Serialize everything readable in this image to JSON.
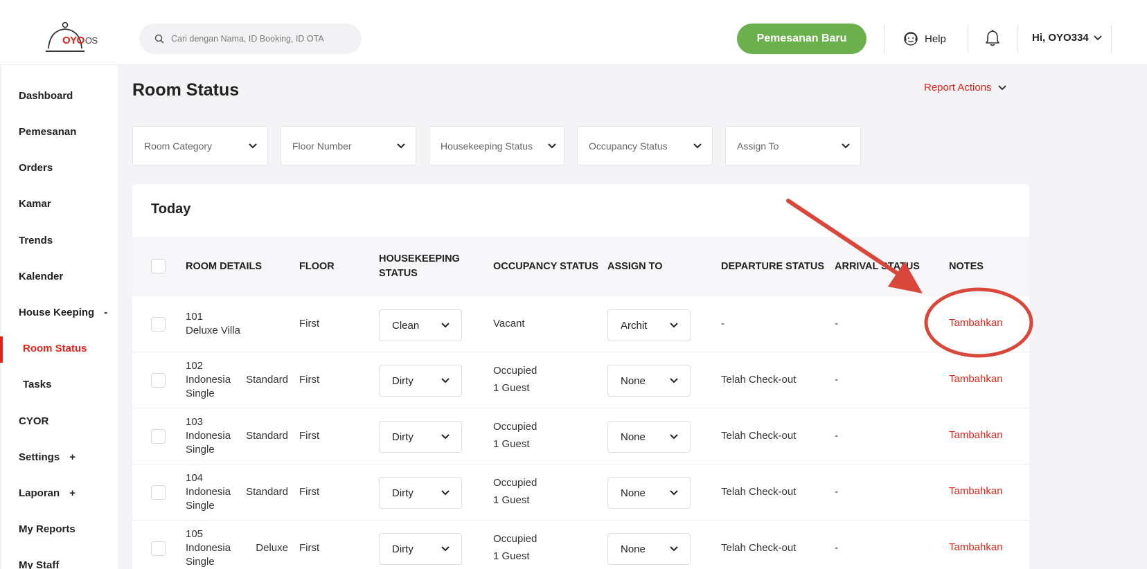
{
  "header": {
    "logo_text": "OYO",
    "logo_suffix": "OS",
    "search_placeholder": "Cari dengan Nama, ID Booking, ID OTA",
    "new_booking_label": "Pemesanan Baru",
    "help_label": "Help",
    "user_greeting": "Hi, OYO334",
    "icons": [
      "search-icon",
      "help-icon",
      "bell-icon",
      "chevron-down-icon"
    ]
  },
  "sidebar": {
    "items": [
      {
        "label": "Dashboard"
      },
      {
        "label": "Pemesanan"
      },
      {
        "label": "Orders"
      },
      {
        "label": "Kamar"
      },
      {
        "label": "Trends"
      },
      {
        "label": "Kalender"
      },
      {
        "label": "House Keeping",
        "sign": "-"
      },
      {
        "label": "Room Status",
        "active": true
      },
      {
        "label": "Tasks"
      },
      {
        "label": "CYOR"
      },
      {
        "label": "Settings",
        "sign": "+"
      },
      {
        "label": "Laporan",
        "sign": "+"
      },
      {
        "label": "My Reports"
      },
      {
        "label": "My Staff"
      }
    ]
  },
  "main": {
    "title": "Room Status",
    "report_actions_label": "Report Actions",
    "filters": [
      "Room Category",
      "Floor Number",
      "Housekeeping Status",
      "Occupancy Status",
      "Assign To"
    ],
    "section_title": "Today",
    "columns": {
      "room_details": "ROOM DETAILS",
      "floor": "FLOOR",
      "housekeeping_1": "HOUSEKEEPING",
      "housekeeping_2": "STATUS",
      "occupancy": "OCCUPANCY STATUS",
      "assign_to": "ASSIGN TO",
      "departure": "DEPARTURE STATUS",
      "arrival": "ARRIVAL STATUS",
      "notes": "NOTES"
    },
    "rows": [
      {
        "room_number": "101",
        "room_name": "Deluxe Villa",
        "floor": "First",
        "housekeeping": "Clean",
        "occupancy": "Vacant",
        "occupancy_guests": "",
        "assign_to": "Archit",
        "departure": "-",
        "arrival": "-",
        "notes_link": "Tambahkan"
      },
      {
        "room_number": "102",
        "room_name": "Indonesia Standard Single",
        "floor": "First",
        "housekeeping": "Dirty",
        "occupancy": "Occupied",
        "occupancy_guests": "1 Guest",
        "assign_to": "None",
        "departure": "Telah Check-out",
        "arrival": "-",
        "notes_link": "Tambahkan"
      },
      {
        "room_number": "103",
        "room_name": "Indonesia Standard Single",
        "floor": "First",
        "housekeeping": "Dirty",
        "occupancy": "Occupied",
        "occupancy_guests": "1 Guest",
        "assign_to": "None",
        "departure": "Telah Check-out",
        "arrival": "-",
        "notes_link": "Tambahkan"
      },
      {
        "room_number": "104",
        "room_name": "Indonesia Standard Single",
        "floor": "First",
        "housekeeping": "Dirty",
        "occupancy": "Occupied",
        "occupancy_guests": "1 Guest",
        "assign_to": "None",
        "departure": "Telah Check-out",
        "arrival": "-",
        "notes_link": "Tambahkan"
      },
      {
        "room_number": "105",
        "room_name": "Indonesia Deluxe Single",
        "floor": "First",
        "housekeeping": "Dirty",
        "occupancy": "Occupied",
        "occupancy_guests": "1 Guest",
        "assign_to": "None",
        "departure": "Telah Check-out",
        "arrival": "-",
        "notes_link": "Tambahkan"
      }
    ]
  },
  "colors": {
    "brand_red": "#e2231a",
    "primary_green": "#6ab04c",
    "annotation_red": "#d9473a",
    "background": "#f4f4f6"
  }
}
